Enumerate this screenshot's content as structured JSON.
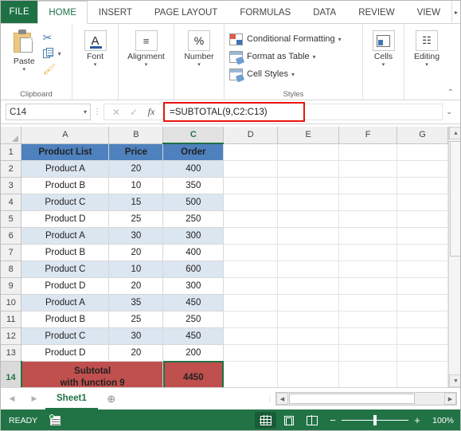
{
  "ribbon": {
    "file_tab": "FILE",
    "tabs": [
      {
        "label": "HOME",
        "active": true
      },
      {
        "label": "INSERT",
        "active": false
      },
      {
        "label": "PAGE LAYOUT",
        "active": false
      },
      {
        "label": "FORMULAS",
        "active": false
      },
      {
        "label": "DATA",
        "active": false
      },
      {
        "label": "REVIEW",
        "active": false
      },
      {
        "label": "VIEW",
        "active": false
      }
    ],
    "more_tabs_glyph": "▸",
    "groups": {
      "clipboard": {
        "label": "Clipboard",
        "paste_label": "Paste",
        "cut_icon": "✂",
        "copy_icon": "copy-icon",
        "format_painter_icon": "὘C",
        "dialog_launcher": "⤵"
      },
      "font": {
        "label": "Font",
        "glyph": "A"
      },
      "alignment": {
        "label": "Alignment",
        "glyph": "≡"
      },
      "number": {
        "label": "Number",
        "glyph": "%"
      },
      "styles": {
        "label": "Styles",
        "items": [
          {
            "label": "Conditional Formatting",
            "caret": "▾"
          },
          {
            "label": "Format as Table",
            "caret": "▾"
          },
          {
            "label": "Cell Styles",
            "caret": "▾"
          }
        ]
      },
      "cells": {
        "label": "Cells"
      },
      "editing": {
        "label": "Editing",
        "glyph": "♛"
      }
    },
    "collapse_glyph": "⌃",
    "caret": "▾"
  },
  "formula_bar": {
    "name_box_value": "C14",
    "name_box_caret": "▾",
    "split_dots": "⋮",
    "cancel_glyph": "✕",
    "enter_glyph": "✓",
    "fx_glyph": "fx",
    "formula": "=SUBTOTAL(9,C2:C13)",
    "expand_glyph": "⌄",
    "highlight_color": "#e8130f"
  },
  "grid": {
    "column_headers": [
      "A",
      "B",
      "C",
      "D",
      "E",
      "F",
      "G"
    ],
    "selected_column": "C",
    "selected_row": "14",
    "row_numbers": [
      "1",
      "2",
      "3",
      "4",
      "5",
      "6",
      "7",
      "8",
      "9",
      "10",
      "11",
      "12",
      "13",
      "14"
    ],
    "corner_glyph": "◢",
    "header_row": {
      "a": "Product List",
      "b": "Price",
      "c": "Order"
    },
    "rows": [
      {
        "row": "2",
        "a": "Product A",
        "b": "20",
        "c": "400",
        "banded": true
      },
      {
        "row": "3",
        "a": "Product B",
        "b": "10",
        "c": "350",
        "banded": false
      },
      {
        "row": "4",
        "a": "Product C",
        "b": "15",
        "c": "500",
        "banded": true
      },
      {
        "row": "5",
        "a": "Product D",
        "b": "25",
        "c": "250",
        "banded": false
      },
      {
        "row": "6",
        "a": "Product A",
        "b": "30",
        "c": "300",
        "banded": true
      },
      {
        "row": "7",
        "a": "Product B",
        "b": "20",
        "c": "400",
        "banded": false
      },
      {
        "row": "8",
        "a": "Product C",
        "b": "10",
        "c": "600",
        "banded": true
      },
      {
        "row": "9",
        "a": "Product D",
        "b": "20",
        "c": "300",
        "banded": false
      },
      {
        "row": "10",
        "a": "Product A",
        "b": "35",
        "c": "450",
        "banded": true
      },
      {
        "row": "11",
        "a": "Product B",
        "b": "25",
        "c": "250",
        "banded": false
      },
      {
        "row": "12",
        "a": "Product C",
        "b": "30",
        "c": "450",
        "banded": true
      },
      {
        "row": "13",
        "a": "Product D",
        "b": "20",
        "c": "200",
        "banded": false
      }
    ],
    "total_row": {
      "row": "14",
      "label_line1": "Subtotal",
      "label_line2": "with function 9",
      "value": "4450",
      "fill_color": "#c0504d",
      "text_color": "#ffffff"
    },
    "header_fill_color": "#4e81bd",
    "band_color": "#dce6f1",
    "active_cell_border_color": "#1e7145"
  },
  "sheet_tabs": {
    "prev_glyph": "◀",
    "next_glyph": "▶",
    "tabs": [
      {
        "label": "Sheet1",
        "active": true
      }
    ],
    "add_sheet_glyph": "⊕",
    "split_glyph": "⋮",
    "hscroll_left_glyph": "◀",
    "hscroll_right_glyph": "▶"
  },
  "scrollbar": {
    "up_glyph": "▲",
    "down_glyph": "▼"
  },
  "status_bar": {
    "status": "READY",
    "macro_record_icon": "record-macro-icon",
    "views": [
      {
        "name": "normal",
        "active": true
      },
      {
        "name": "page-layout",
        "active": false
      },
      {
        "name": "page-break-preview",
        "active": false
      }
    ],
    "zoom_out_glyph": "−",
    "zoom_in_glyph": "+",
    "zoom_level": "100%",
    "background_color": "#217346"
  }
}
